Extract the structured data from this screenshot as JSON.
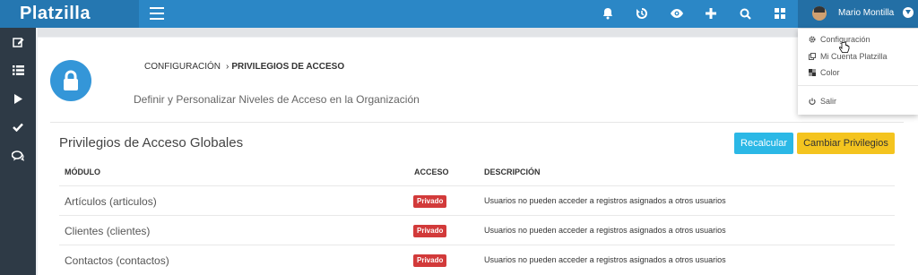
{
  "app": {
    "brand": "Platzilla"
  },
  "topbar": {
    "icons": [
      "bell-icon",
      "history-icon",
      "eye-icon",
      "plus-icon",
      "search-icon",
      "grid-icon"
    ],
    "user_name": "Mario Montilla"
  },
  "user_menu": {
    "items": [
      {
        "icon": "gear-icon",
        "label": "Configuración"
      },
      {
        "icon": "copy-icon",
        "label": "Mi Cuenta Platzilla"
      },
      {
        "icon": "palette-icon",
        "label": "Color"
      },
      {
        "icon": "power-icon",
        "label": "Salir"
      }
    ]
  },
  "sidebar": {
    "items": [
      "edit-icon",
      "list-icon",
      "play-icon",
      "check-icon",
      "comments-icon"
    ]
  },
  "header": {
    "breadcrumb": {
      "parent": "CONFIGURACIÓN",
      "separator": "›",
      "current": "PRIVILEGIOS DE ACCESO"
    },
    "subtitle": "Definir y Personalizar Niveles de Acceso en la Organización",
    "icon": "lock-icon"
  },
  "privileges": {
    "title": "Privilegios de Acceso Globales",
    "buttons": {
      "recalc": "Recalcular",
      "change": "Cambiar Privilegios"
    },
    "columns": {
      "module": "MÓDULO",
      "access": "ACCESO",
      "description": "DESCRIPCIÓN"
    },
    "rows": [
      {
        "module": "Artículos (articulos)",
        "access": "Privado",
        "description": "Usuarios no pueden acceder a registros asignados a otros usuarios"
      },
      {
        "module": "Clientes (clientes)",
        "access": "Privado",
        "description": "Usuarios no pueden acceder a registros asignados a otros usuarios"
      },
      {
        "module": "Contactos (contactos)",
        "access": "Privado",
        "description": "Usuarios no pueden acceder a registros asignados a otros usuarios"
      }
    ]
  },
  "colors": {
    "topbar": "#2b87c6",
    "brand_bg": "#2577b1",
    "sidebar": "#2e3a46",
    "recalc": "#2bb8e6",
    "change": "#f4c41f",
    "badge": "#d23a3a",
    "lock": "#3496d8"
  }
}
